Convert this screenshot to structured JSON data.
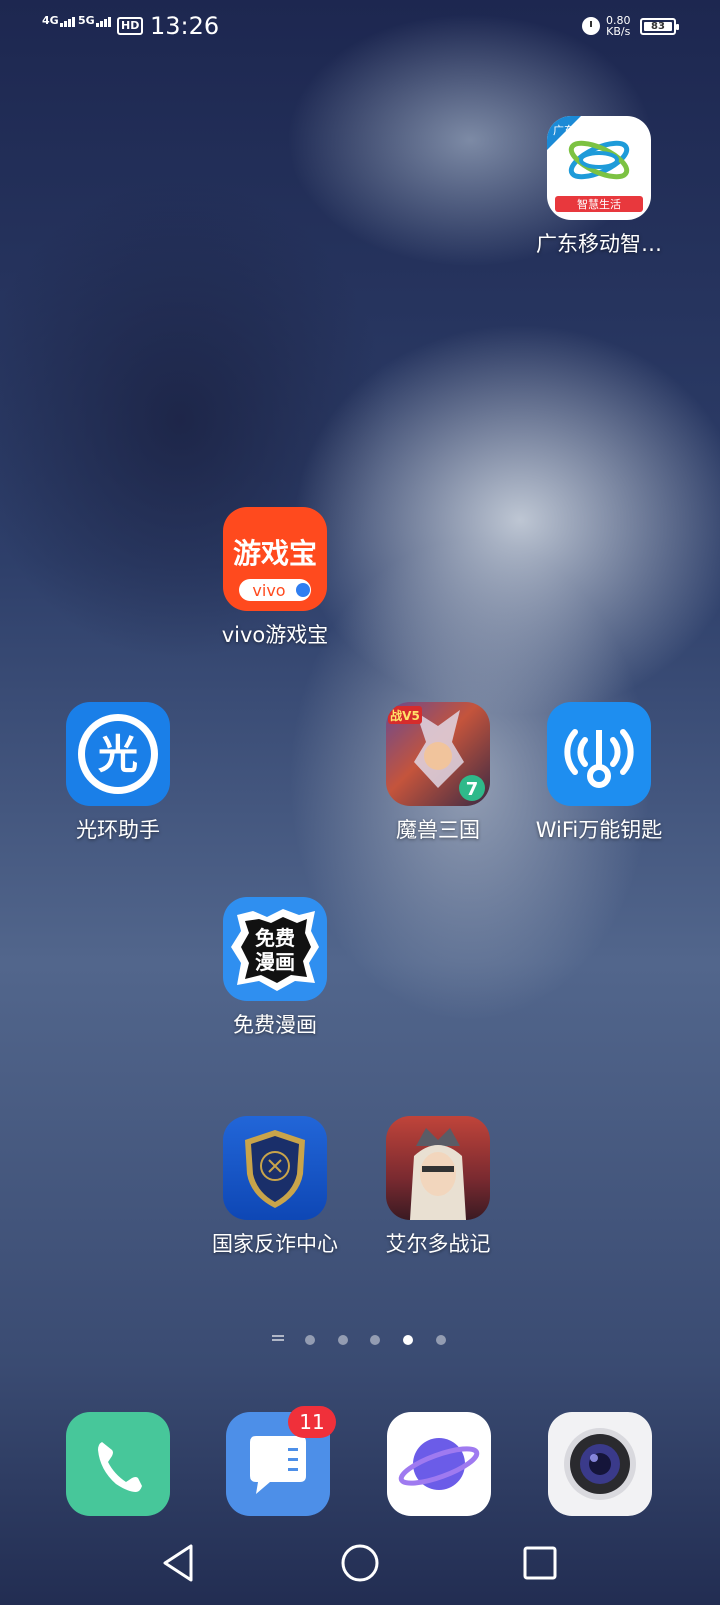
{
  "status_bar": {
    "network1": "4G",
    "network2": "5G",
    "hd": "HD",
    "time": "13:26",
    "speed_value": "0.80",
    "speed_unit": "KB/s",
    "battery": "83"
  },
  "apps": {
    "guangdong_mobile": "广东移动智…",
    "vivo_games": "vivo游戏宝",
    "guanghuan": "光环助手",
    "moshou": "魔兽三国",
    "wifi_key": "WiFi万能钥匙",
    "free_comics": "免费漫画",
    "anti_fraud": "国家反诈中心",
    "aier": "艾尔多战记"
  },
  "icon_text": {
    "guangdong_corner": "广东",
    "guangdong_banner": "智慧生活",
    "vivo_title": "游戏宝",
    "vivo_brand": "vivo",
    "guanghuan_char": "光",
    "comics_line1": "免费",
    "comics_line2": "漫画",
    "moshou_tag": "战V5",
    "moshou_num": "7"
  },
  "page_indicator": {
    "count": 5,
    "active_index": 3
  },
  "dock": {
    "messages_badge": "11",
    "items": [
      "phone-icon",
      "messages-icon",
      "browser-icon",
      "camera-icon"
    ]
  },
  "colors": {
    "phone": "#47c79a",
    "messages": "#4d8fe8",
    "badge": "#f0303a",
    "vivo_games": "#ff4a1e",
    "wifi_key": "#1e8ef0",
    "guanghuan": "#1a7fe8"
  }
}
